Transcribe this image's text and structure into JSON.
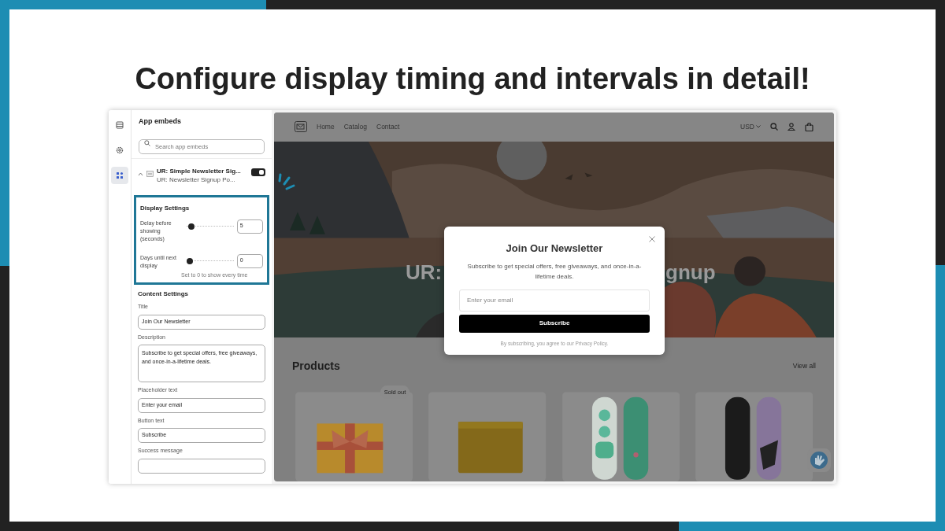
{
  "headline": "Configure display timing and intervals in detail!",
  "rail": [
    {
      "kind": "layout",
      "selected": false
    },
    {
      "kind": "settings",
      "selected": false
    },
    {
      "kind": "apps",
      "selected": true
    }
  ],
  "panel": {
    "title": "App embeds",
    "search": {
      "placeholder": "Search app embeds"
    },
    "embed": {
      "name": "UR: Simple Newsletter Sig...",
      "subtitle": "UR: Newsletter Signup Po...",
      "expanded": true,
      "on": true
    },
    "display_settings": {
      "title": "Display Settings",
      "highlighted": true,
      "fields": [
        {
          "label": "Delay before showing (seconds)",
          "level": 0.05,
          "value": "5"
        },
        {
          "label": "Days until next display",
          "level": 0,
          "value": "0",
          "hint": "Set to 0 to show every time"
        }
      ]
    },
    "content_settings": {
      "title": "Content Settings",
      "fields": [
        {
          "label": "Title",
          "kind": "input",
          "value": "Join Our Newsletter"
        },
        {
          "label": "Description",
          "kind": "textarea",
          "value": "Subscribe to get special offers, free giveaways, and once-in-a-lifetime deals."
        },
        {
          "label": "Placeholder text",
          "kind": "input",
          "value": "Enter your email"
        },
        {
          "label": "Button text",
          "kind": "input",
          "value": "Subscribe"
        },
        {
          "label": "Success message",
          "kind": "cut"
        }
      ]
    }
  },
  "store": {
    "nav": [
      "Home",
      "Catalog",
      "Contact"
    ],
    "currency": "USD",
    "hero_text": [
      "UR:",
      "gnup"
    ],
    "products_title": "Products",
    "view_all": "View all",
    "products": [
      {
        "badge": "Sold out",
        "kind": "gift"
      },
      {
        "kind": "block"
      },
      {
        "kind": "boards-green"
      },
      {
        "kind": "boards-dark"
      }
    ]
  },
  "modal": {
    "title": "Join Our Newsletter",
    "description": "Subscribe to get special offers, free giveaways, and once-in-a-lifetime deals.",
    "placeholder": "Enter your email",
    "button": "Subscribe",
    "note": "By subscribing, you agree to our Privacy Policy."
  }
}
